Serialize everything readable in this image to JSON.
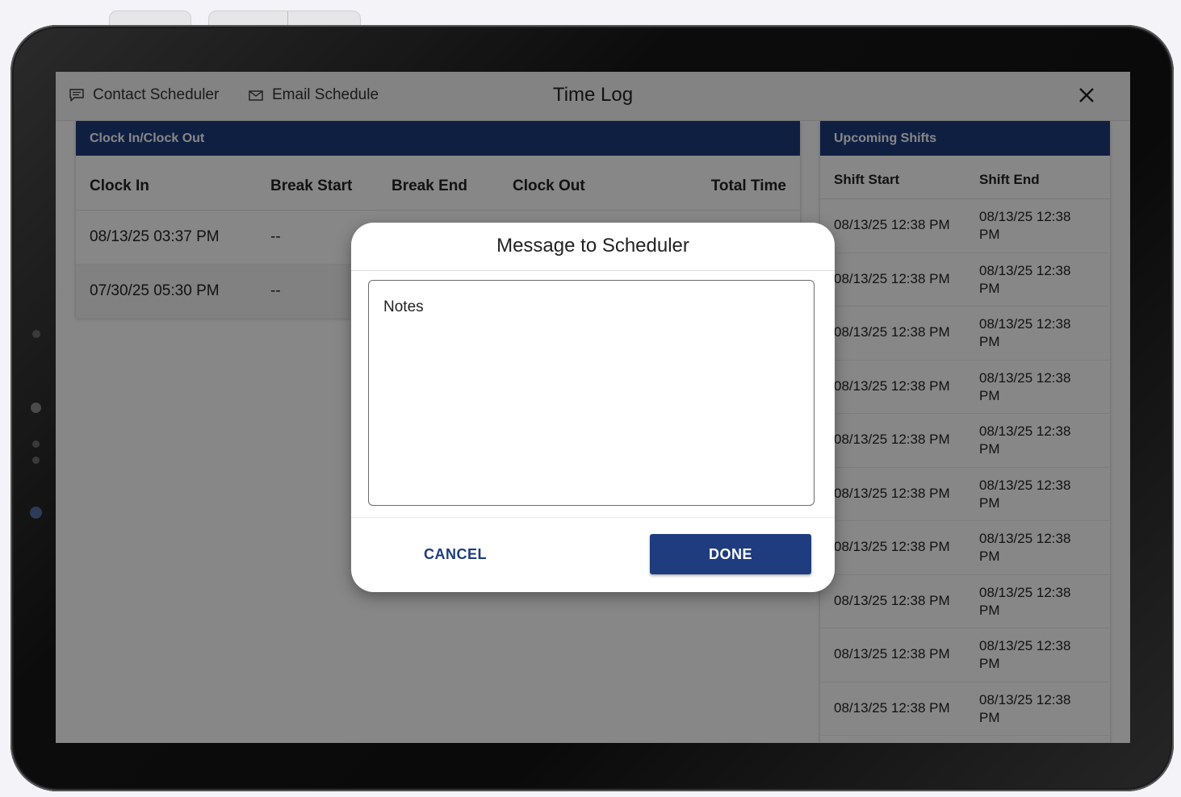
{
  "app": {
    "title": "Time Log",
    "contact_label": "Contact Scheduler",
    "email_label": "Email Schedule"
  },
  "clock_panel": {
    "title": "Clock In/Clock Out",
    "columns": [
      "Clock In",
      "Break Start",
      "Break End",
      "Clock Out",
      "Total Time"
    ],
    "rows": [
      {
        "clock_in": "08/13/25 03:37 PM",
        "break_start": "--"
      },
      {
        "clock_in": "07/30/25 05:30 PM",
        "break_start": "--"
      }
    ]
  },
  "shifts_panel": {
    "title": "Upcoming Shifts",
    "columns": [
      "Shift Start",
      "Shift End"
    ],
    "rows": [
      {
        "start": "08/13/25 12:38 PM",
        "end": "08/13/25 12:38 PM"
      },
      {
        "start": "08/13/25 12:38 PM",
        "end": "08/13/25 12:38 PM"
      },
      {
        "start": "08/13/25 12:38 PM",
        "end": "08/13/25 12:38 PM"
      },
      {
        "start": "08/13/25 12:38 PM",
        "end": "08/13/25 12:38 PM"
      },
      {
        "start": "08/13/25 12:38 PM",
        "end": "08/13/25 12:38 PM"
      },
      {
        "start": "08/13/25 12:38 PM",
        "end": "08/13/25 12:38 PM"
      },
      {
        "start": "08/13/25 12:38 PM",
        "end": "08/13/25 12:38 PM"
      },
      {
        "start": "08/13/25 12:38 PM",
        "end": "08/13/25 12:38 PM"
      },
      {
        "start": "08/13/25 12:38 PM",
        "end": "08/13/25 12:38 PM"
      },
      {
        "start": "08/13/25 12:38 PM",
        "end": "08/13/25 12:38 PM"
      }
    ]
  },
  "dialog": {
    "title": "Message to Scheduler",
    "notes_placeholder": "Notes",
    "cancel_label": "CANCEL",
    "done_label": "DONE"
  },
  "icons": {
    "contact": "chat-icon",
    "email": "envelope-icon",
    "close": "close-icon"
  },
  "colors": {
    "brand": "#1e3c7e",
    "overlay": "rgba(0,0,0,0.47)"
  }
}
